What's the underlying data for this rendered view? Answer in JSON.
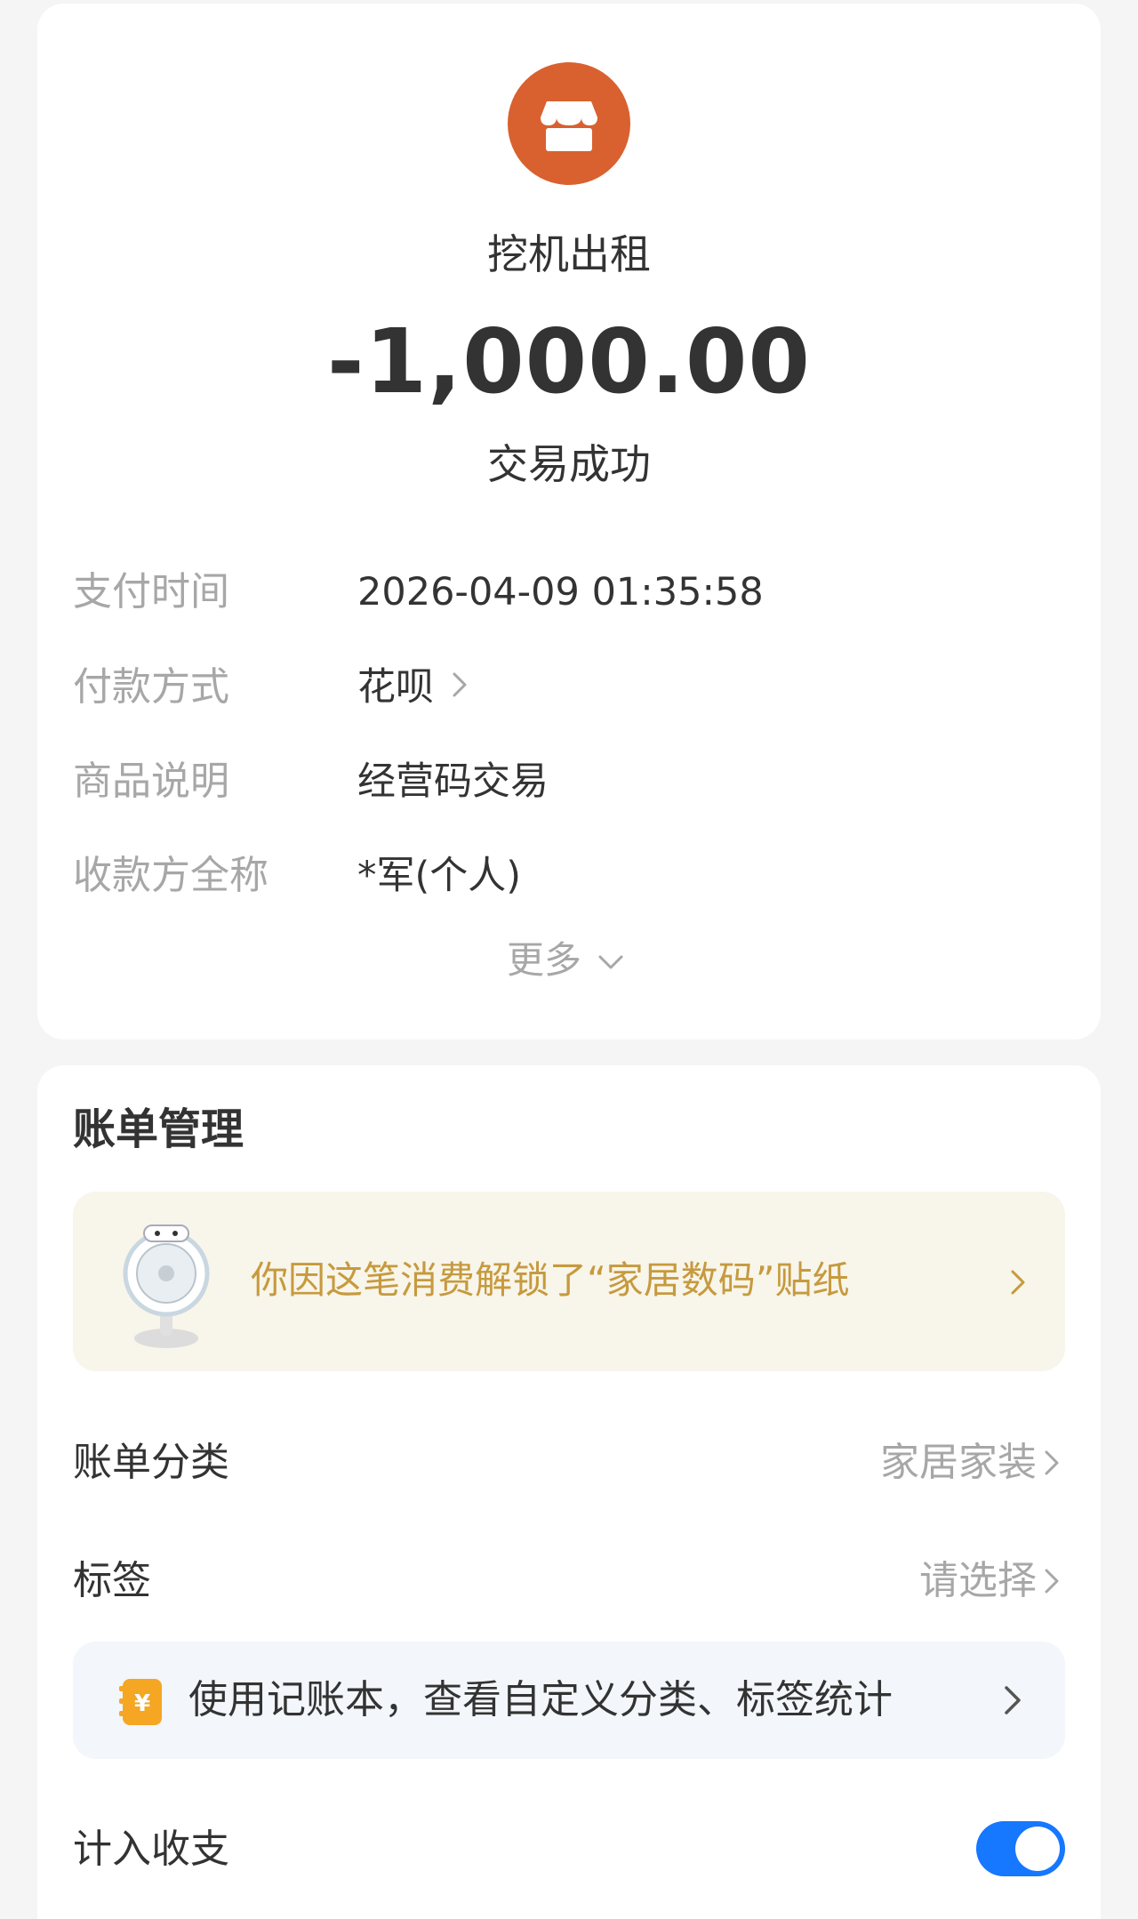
{
  "merchant": {
    "icon": "store-icon",
    "name": "挖机出租",
    "amount": "-1,000.00",
    "status": "交易成功"
  },
  "details": [
    {
      "label": "支付时间",
      "value": "2026-04-09 01:35:58"
    },
    {
      "label": "付款方式",
      "value": "花呗"
    },
    {
      "label": "商品说明",
      "value": "经营码交易"
    },
    {
      "label": "收款方全称",
      "value": "*军(个人)"
    }
  ],
  "more_label": "更多",
  "management": {
    "title": "账单管理",
    "sticker_banner": "你因这笔消费解锁了“家居数码”贴纸",
    "category_label": "账单分类",
    "category_value": "家居家装",
    "tag_label": "标签",
    "tag_value": "请选择",
    "promo_text": "使用记账本，查看自定义分类、标签统计",
    "include_label": "计入收支",
    "include_enabled": true
  },
  "colors": {
    "logo": "#d9612f",
    "toggle": "#1677ff",
    "banner_text": "#c69a3e"
  }
}
